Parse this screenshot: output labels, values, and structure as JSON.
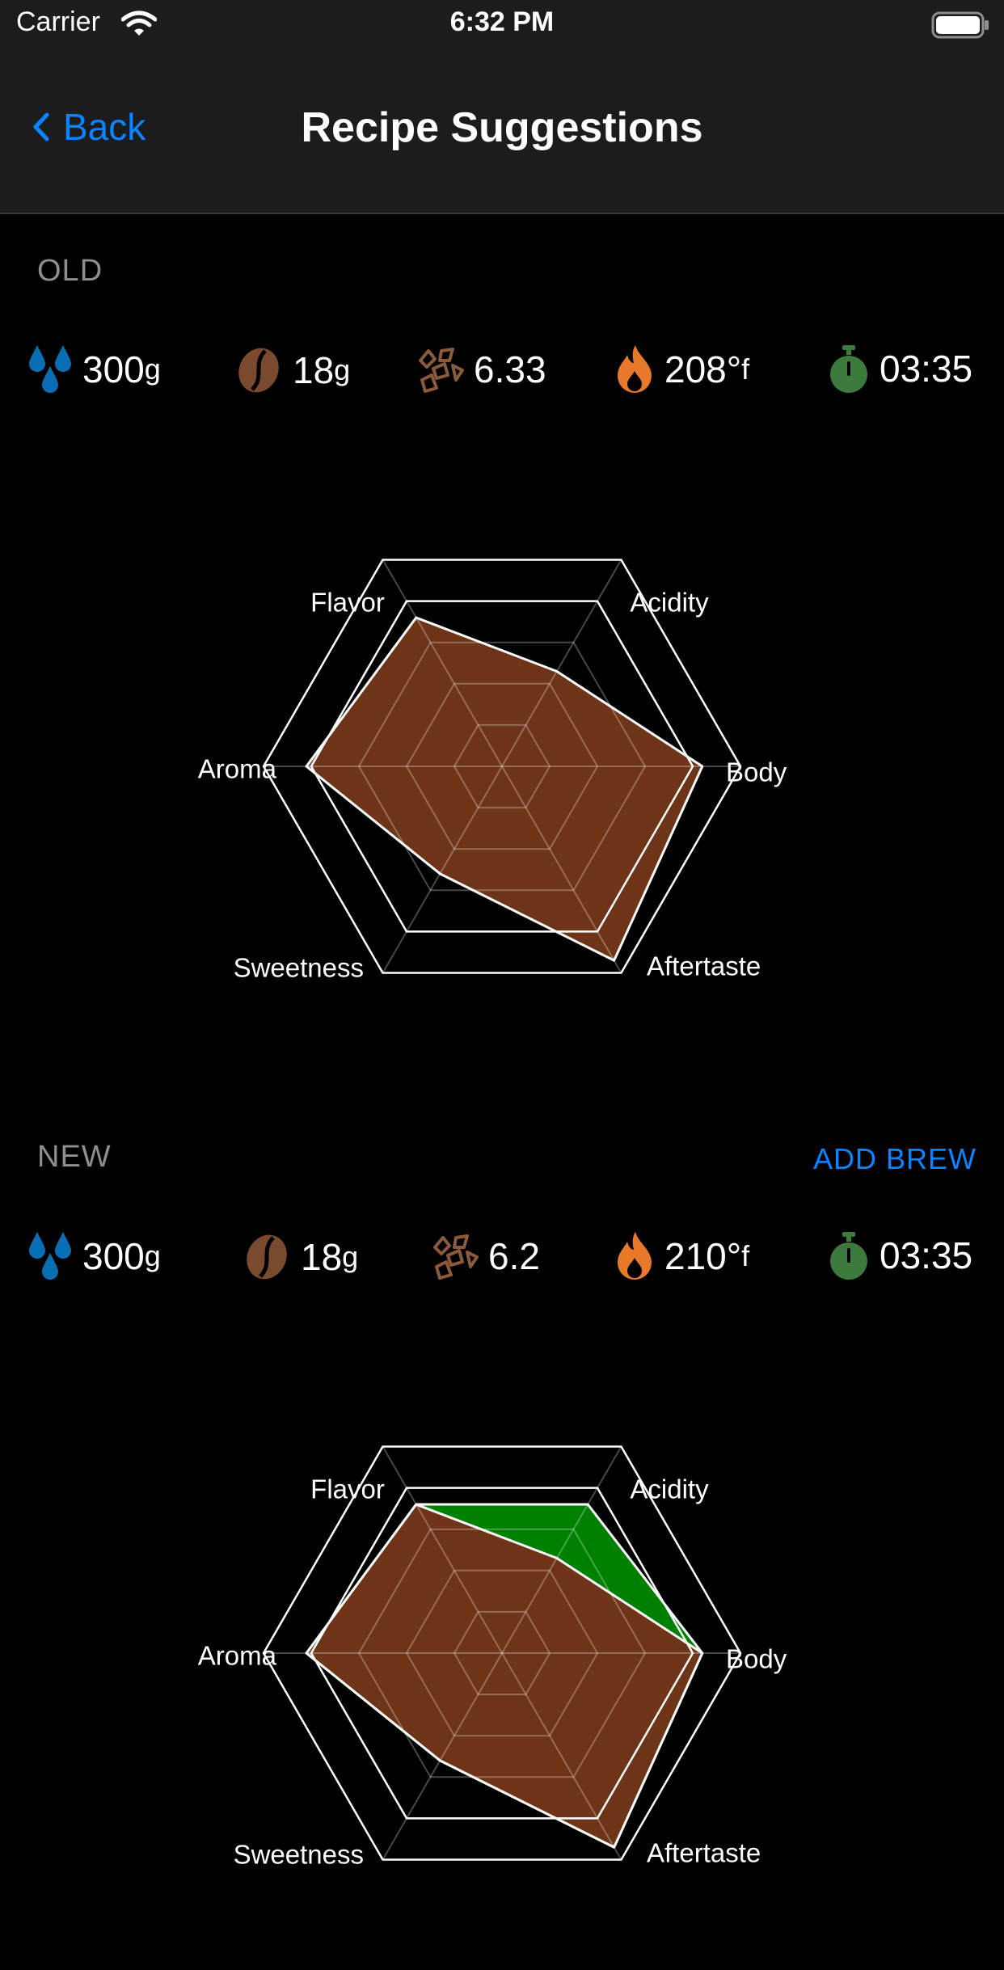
{
  "status": {
    "carrier": "Carrier",
    "time": "6:32 PM"
  },
  "nav": {
    "back_label": "Back",
    "title": "Recipe Suggestions"
  },
  "axes": [
    "Flavor",
    "Acidity",
    "Body",
    "Aftertaste",
    "Sweetness",
    "Aroma"
  ],
  "colors": {
    "accent": "#0a84ff",
    "water": "#0a6eb4",
    "bean": "#7a4a2f",
    "grind": "#8a5a3a",
    "temp": "#e8792a",
    "timer": "#3d7a3d",
    "profile_fill": "#6e3418",
    "improvement_fill": "#008000"
  },
  "old": {
    "label": "OLD",
    "metrics": {
      "water": {
        "value": "300",
        "unit": "g"
      },
      "coffee": {
        "value": "18",
        "unit": "g"
      },
      "grind": {
        "value": "6.33"
      },
      "temp": {
        "value": "208°",
        "unit": "f"
      },
      "time": {
        "value": "03:35"
      }
    }
  },
  "new": {
    "label": "NEW",
    "add_brew": "ADD BREW",
    "metrics": {
      "water": {
        "value": "300",
        "unit": "g"
      },
      "coffee": {
        "value": "18",
        "unit": "g"
      },
      "grind": {
        "value": "6.2"
      },
      "temp": {
        "value": "210°",
        "unit": "f"
      },
      "time": {
        "value": "03:35"
      }
    }
  },
  "chart_data": [
    {
      "type": "radar",
      "axes": [
        "Flavor",
        "Acidity",
        "Body",
        "Aftertaste",
        "Sweetness",
        "Aroma"
      ],
      "max": 5,
      "series": [
        {
          "values": [
            3.6,
            2.3,
            4.2,
            4.7,
            2.6,
            4.1
          ]
        }
      ]
    },
    {
      "type": "radar",
      "axes": [
        "Flavor",
        "Acidity",
        "Body",
        "Aftertaste",
        "Sweetness",
        "Aroma"
      ],
      "max": 5,
      "series": [
        {
          "values": [
            3.6,
            2.3,
            4.2,
            4.7,
            2.6,
            4.1
          ]
        },
        {
          "values": [
            3.6,
            3.6,
            4.2,
            4.7,
            2.6,
            4.1
          ]
        }
      ]
    }
  ]
}
